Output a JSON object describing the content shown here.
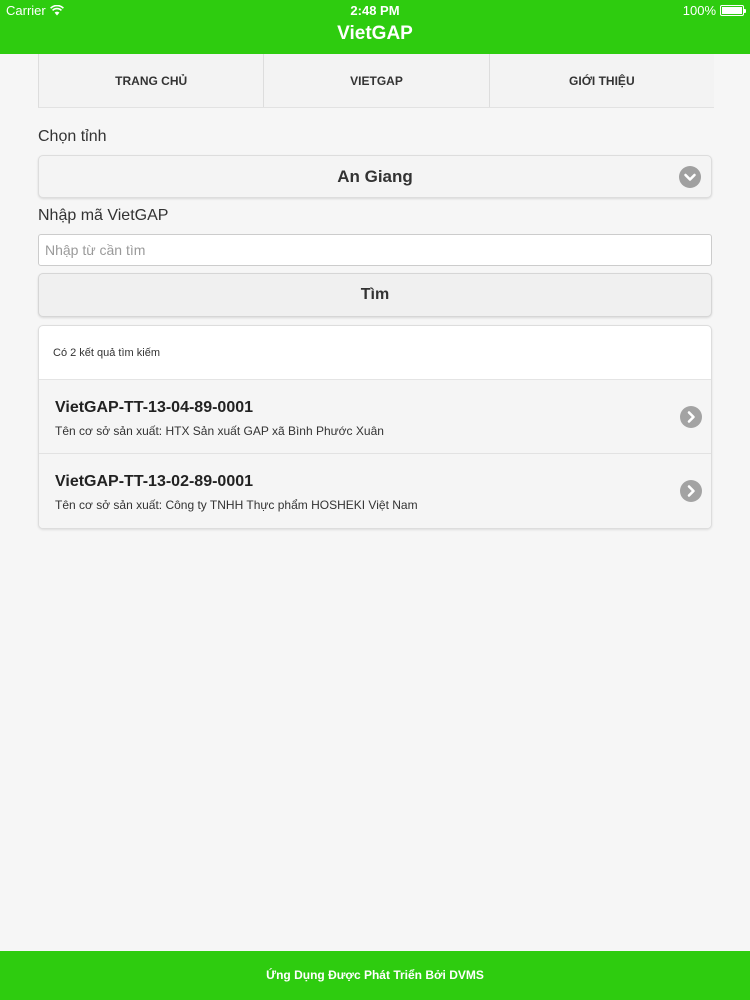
{
  "status_bar": {
    "carrier": "Carrier",
    "time": "2:48 PM",
    "battery": "100%"
  },
  "header": {
    "title": "VietGAP"
  },
  "tabs": [
    {
      "label": "TRANG CHỦ"
    },
    {
      "label": "VIETGAP"
    },
    {
      "label": "GIỚI THIỆU"
    }
  ],
  "form": {
    "province_label": "Chọn tỉnh",
    "province_value": "An Giang",
    "code_label": "Nhập mã VietGAP",
    "code_placeholder": "Nhập từ cần tìm",
    "code_value": "",
    "search_button": "Tìm"
  },
  "results": {
    "summary": "Có 2 kết quả tìm kiếm",
    "items": [
      {
        "code": "VietGAP-TT-13-04-89-0001",
        "producer": "Tên cơ sở sản xuất: HTX Sản xuất GAP xã Bình Phước Xuân"
      },
      {
        "code": "VietGAP-TT-13-02-89-0001",
        "producer": "Tên cơ sở sản xuất: Công ty TNHH Thực phẩm HOSHEKI Việt Nam"
      }
    ]
  },
  "footer": {
    "text": "Ứng Dụng Được Phát Triển Bởi DVMS"
  },
  "colors": {
    "brand_green": "#2ecc0f",
    "icon_gray": "#a0a0a0"
  },
  "icons": {
    "wifi": "wifi-icon",
    "battery": "battery-icon",
    "dropdown": "chevron-down-circle-icon",
    "row_arrow": "chevron-right-circle-icon"
  }
}
